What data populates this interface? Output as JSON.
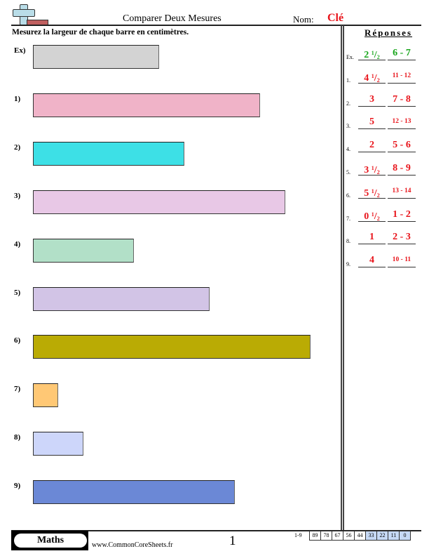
{
  "header": {
    "title": "Comparer Deux Mesures",
    "name_label": "Nom:",
    "name_value": "Clé",
    "instructions": "Mesurez la largeur de chaque barre en centimètres."
  },
  "logo_icon": "cross-and-ruler-icon",
  "problems": [
    {
      "label": "Ex)",
      "color": "#d3d3d3",
      "answer_cm": 2.5
    },
    {
      "label": "1)",
      "color": "#f0b3c8",
      "answer_cm": 4.5
    },
    {
      "label": "2)",
      "color": "#3de0e6",
      "answer_cm": 3
    },
    {
      "label": "3)",
      "color": "#e8c8e6",
      "answer_cm": 5
    },
    {
      "label": "4)",
      "color": "#b2e0c8",
      "answer_cm": 2
    },
    {
      "label": "5)",
      "color": "#d2c4e6",
      "answer_cm": 3.5
    },
    {
      "label": "6)",
      "color": "#baab04",
      "answer_cm": 5.5
    },
    {
      "label": "7)",
      "color": "#ffc875",
      "answer_cm": 0.5
    },
    {
      "label": "8)",
      "color": "#cdd6fa",
      "answer_cm": 1
    },
    {
      "label": "9)",
      "color": "#6b88d6",
      "answer_cm": 4
    }
  ],
  "answers": {
    "title": "Réponses",
    "rows": [
      {
        "num": "Ex.",
        "whole": "2",
        "half": true,
        "range": "6 - 7"
      },
      {
        "num": "1.",
        "whole": "4",
        "half": true,
        "range": "11 - 12"
      },
      {
        "num": "2.",
        "whole": "3",
        "half": false,
        "range": "7 - 8"
      },
      {
        "num": "3.",
        "whole": "5",
        "half": false,
        "range": "12 - 13"
      },
      {
        "num": "4.",
        "whole": "2",
        "half": false,
        "range": "5 - 6"
      },
      {
        "num": "5.",
        "whole": "3",
        "half": true,
        "range": "8 - 9"
      },
      {
        "num": "6.",
        "whole": "5",
        "half": true,
        "range": "13 - 14"
      },
      {
        "num": "7.",
        "whole": "0",
        "half": true,
        "range": "1 - 2"
      },
      {
        "num": "8.",
        "whole": "1",
        "half": false,
        "range": "2 - 3"
      },
      {
        "num": "9.",
        "whole": "4",
        "half": false,
        "range": "10 - 11"
      }
    ],
    "fraction_num": "1",
    "fraction_den": "2",
    "example_color": "#18a51b",
    "answer_color": "#e8141b"
  },
  "footer": {
    "subject": "Maths",
    "website": "www.CommonCoreSheets.fr",
    "page": "1",
    "score_range": "1-9",
    "scores": [
      "89",
      "78",
      "67",
      "56",
      "44",
      "33",
      "22",
      "11",
      "0"
    ],
    "highlighted_scores": [
      "33",
      "22",
      "11",
      "0"
    ]
  }
}
